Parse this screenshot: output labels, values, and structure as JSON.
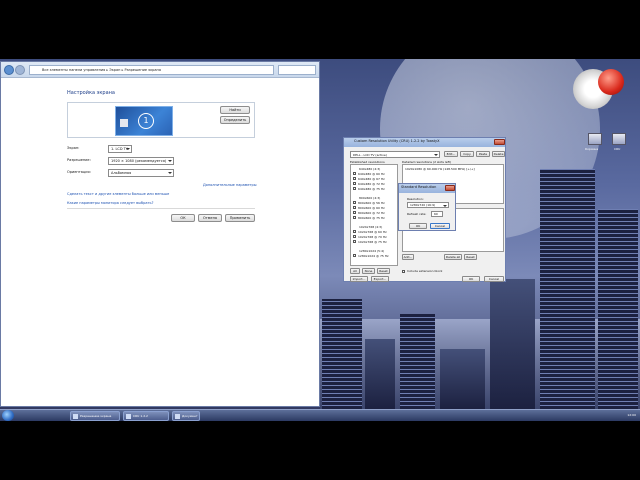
{
  "control_panel": {
    "address": [
      "Все элементы панели управления",
      "Экран",
      "Разрешение экрана"
    ],
    "title": "Настройка экрана",
    "monitor_number": "1",
    "find_label": "Найти",
    "identify_label": "Определить",
    "display_label": "Экран:",
    "display_value": "1. LCD TV",
    "resolution_label": "Разрешение:",
    "resolution_value": "1920 × 1080 (рекомендуется)",
    "orientation_label": "Ориентация:",
    "orientation_value": "Альбомная",
    "advanced_link": "Дополнительные параметры",
    "link_text_size": "Сделать текст и другие элементы больше или меньше",
    "link_which_settings": "Какие параметры монитора следует выбрать?",
    "ok_label": "ОК",
    "cancel_label": "Отмена",
    "apply_label": "Применить"
  },
  "cru": {
    "title": "Custom Resolution Utility (CRU) 1.2.2 by ToastyX",
    "device_value": "DELL - LCD TV (active)",
    "edit_label": "Edit...",
    "copy_label": "Copy",
    "paste_label": "Paste",
    "delete_label": "Delete",
    "established_title": "Established resolutions",
    "detailed_title": "Detailed resolutions (2 slots left)",
    "detailed_item": "1920x1080 @ 60.000 Hz (148.500 MHz) [+/+]",
    "group_640": "640x480 (4:3)",
    "items_640": [
      "640x480 @ 60 Hz",
      "640x480 @ 67 Hz",
      "640x480 @ 72 Hz",
      "640x480 @ 75 Hz"
    ],
    "group_800": "800x600 (4:3)",
    "items_800": [
      "800x600 @ 56 Hz",
      "800x600 @ 60 Hz",
      "800x600 @ 72 Hz",
      "800x600 @ 75 Hz"
    ],
    "group_1024": "1024x768 (4:3)",
    "items_1024": [
      "1024x768 @ 60 Hz",
      "1024x768 @ 70 Hz",
      "1024x768 @ 75 Hz"
    ],
    "group_1280": "1280x1024 (5:4)",
    "items_1280": [
      "1280x1024 @ 75 Hz"
    ],
    "all_label": "All",
    "none_label": "None",
    "reset_label": "Reset",
    "add_label": "Add...",
    "delete_all_label": "Delete all",
    "reset_all_label": "Reset",
    "include_ext_label": "Include extension block",
    "import_label": "Import...",
    "export_label": "Export...",
    "ok_label": "OK",
    "cancel_label": "Cancel"
  },
  "std_dialog": {
    "title": "Standard Resolution",
    "resolution_label": "Resolution:",
    "resolution_value": "1280x720 (16:9)",
    "refresh_label": "Refresh rate:",
    "refresh_value": "60",
    "ok_label": "OK",
    "cancel_label": "Cancel"
  },
  "desktop": {
    "icon1_label": "Корзина",
    "icon2_label": "CRU"
  },
  "taskbar": {
    "tasks": [
      "Разрешение экрана",
      "CRU 1.2.2",
      "Документ"
    ],
    "clock": "12:00"
  },
  "colors": {
    "accent": "#1e3f8a",
    "link": "#1a4fb0",
    "taskbar": "#2c3a63"
  }
}
